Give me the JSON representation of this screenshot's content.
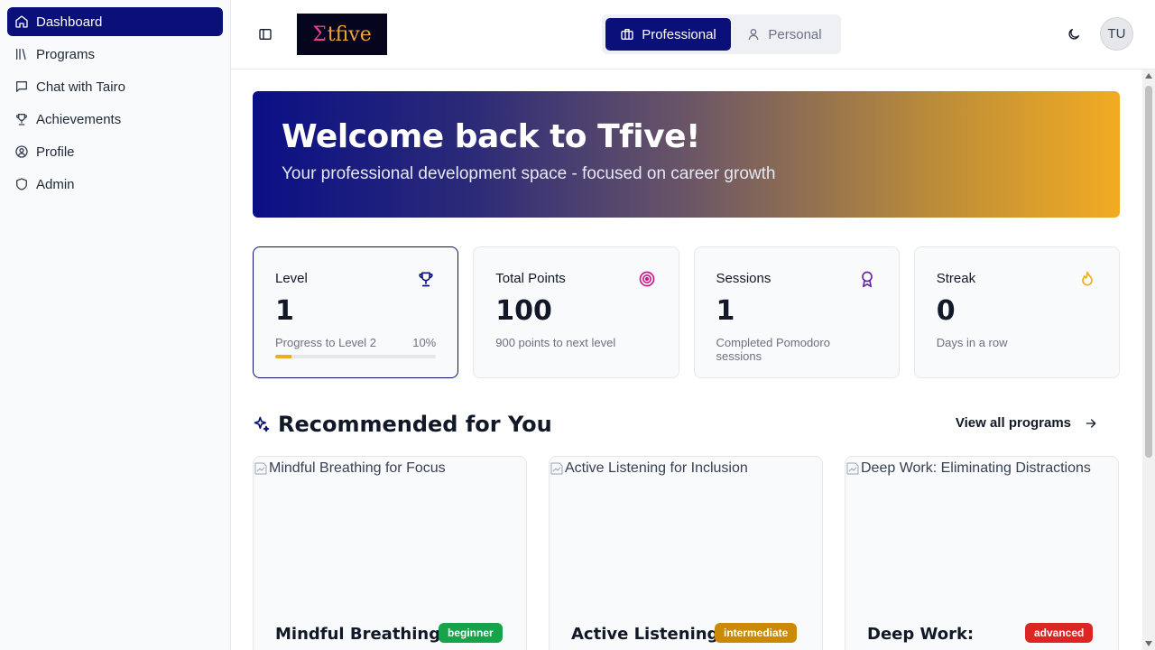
{
  "sidebar": {
    "items": [
      {
        "label": "Dashboard",
        "icon": "home-icon",
        "active": true
      },
      {
        "label": "Programs",
        "icon": "library-icon"
      },
      {
        "label": "Chat with Tairo",
        "icon": "chat-icon"
      },
      {
        "label": "Achievements",
        "icon": "trophy-icon"
      },
      {
        "label": "Profile",
        "icon": "user-circle-icon"
      },
      {
        "label": "Admin",
        "icon": "shield-icon"
      }
    ]
  },
  "header": {
    "logo_text": "tfive",
    "logo_mark": "Σ",
    "modes": [
      {
        "label": "Professional",
        "icon": "briefcase-icon",
        "active": true
      },
      {
        "label": "Personal",
        "icon": "user-icon"
      }
    ],
    "theme_icon": "moon-icon",
    "avatar_initials": "TU"
  },
  "hero": {
    "title": "Welcome back to Tfive!",
    "subtitle": "Your professional development space - focused on career growth"
  },
  "stats": [
    {
      "label": "Level",
      "value": "1",
      "icon": "trophy-icon",
      "progress_label": "Progress to Level 2",
      "progress_text": "10%",
      "progress": 0.1
    },
    {
      "label": "Total Points",
      "value": "100",
      "icon": "target-icon",
      "sub": "900 points to next level"
    },
    {
      "label": "Sessions",
      "value": "1",
      "icon": "award-icon",
      "sub": "Completed Pomodoro sessions"
    },
    {
      "label": "Streak",
      "value": "0",
      "icon": "flame-icon",
      "sub": "Days in a row"
    }
  ],
  "recommended": {
    "title": "Recommended for You",
    "view_all": "View all programs",
    "programs": [
      {
        "image_alt": "Mindful Breathing for Focus",
        "title": "Mindful Breathing",
        "level": "beginner"
      },
      {
        "image_alt": "Active Listening for Inclusion",
        "title": "Active Listening",
        "level": "intermediate"
      },
      {
        "image_alt": "Deep Work: Eliminating Distractions",
        "title": "Deep Work:",
        "level": "advanced"
      }
    ]
  },
  "colors": {
    "primary": "#0b0f7a",
    "accent": "#f2ac22",
    "beginner": "#16a34a",
    "intermediate": "#ca8a04",
    "advanced": "#dc2626"
  }
}
